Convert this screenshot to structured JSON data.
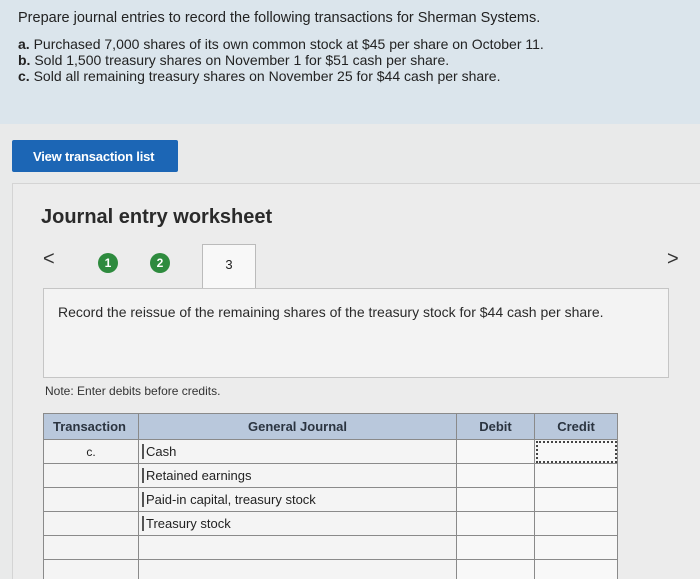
{
  "question": {
    "prompt": "Prepare journal entries to record the following transactions for Sherman Systems.",
    "items": [
      {
        "letter": "a.",
        "text": "Purchased 7,000 shares of its own common stock at $45 per share on October 11."
      },
      {
        "letter": "b.",
        "text": "Sold 1,500 treasury shares on November 1 for $51 cash per share."
      },
      {
        "letter": "c.",
        "text": "Sold all remaining treasury shares on November 25 for $44 cash per share."
      }
    ]
  },
  "view_button_label": "View transaction list",
  "worksheet": {
    "title": "Journal entry worksheet",
    "prev_icon": "<",
    "next_icon": ">",
    "steps": [
      "1",
      "2",
      "3"
    ],
    "instruction": "Record the reissue of the remaining shares of the treasury stock for $44 cash per share.",
    "note": "Note: Enter debits before credits."
  },
  "journal": {
    "headers": {
      "transaction": "Transaction",
      "general_journal": "General Journal",
      "debit": "Debit",
      "credit": "Credit"
    },
    "rows": [
      {
        "transaction": "c.",
        "account": "Cash",
        "debit": "",
        "credit": ""
      },
      {
        "transaction": "",
        "account": "Retained earnings",
        "debit": "",
        "credit": ""
      },
      {
        "transaction": "",
        "account": "Paid-in capital, treasury stock",
        "debit": "",
        "credit": ""
      },
      {
        "transaction": "",
        "account": "Treasury stock",
        "debit": "",
        "credit": ""
      },
      {
        "transaction": "",
        "account": "",
        "debit": "",
        "credit": ""
      },
      {
        "transaction": "",
        "account": "",
        "debit": "",
        "credit": ""
      }
    ]
  }
}
